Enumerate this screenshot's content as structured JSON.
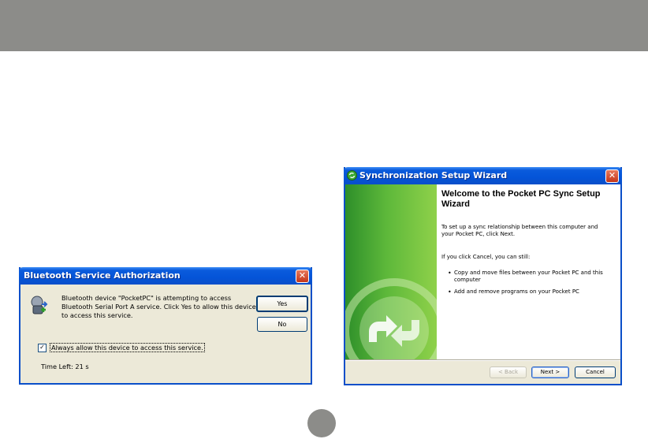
{
  "bluetooth_dialog": {
    "title": "Bluetooth Service Authorization",
    "message": "Bluetooth device \"PocketPC\" is attempting to access Bluetooth Serial Port A service. Click Yes to allow this device to access this service.",
    "yes_label": "Yes",
    "no_label": "No",
    "checkbox_label": "Always allow this device to access this service.",
    "checkbox_checked": true,
    "checkbox_mark": "✓",
    "time_left": "Time Left: 21 s",
    "close_glyph": "✕"
  },
  "sync_wizard": {
    "title": "Synchronization Setup Wizard",
    "heading": "Welcome to the Pocket PC Sync Setup Wizard",
    "intro": "To set up a sync relationship between this computer and your Pocket PC, click Next.",
    "cancel_note": "If you click Cancel, you can still:",
    "bullets": [
      "Copy and move files between your Pocket PC and this computer",
      "Add and remove programs on your Pocket PC"
    ],
    "bullet_glyph": "•",
    "back_label": "< Back",
    "next_label": "Next >",
    "cancel_label": "Cancel",
    "close_glyph": "✕"
  },
  "colors": {
    "band": "#8c8c89",
    "xp_title_blue": "#0454d8",
    "dialog_face": "#ece9d8",
    "wizard_green": "#5db83a"
  }
}
